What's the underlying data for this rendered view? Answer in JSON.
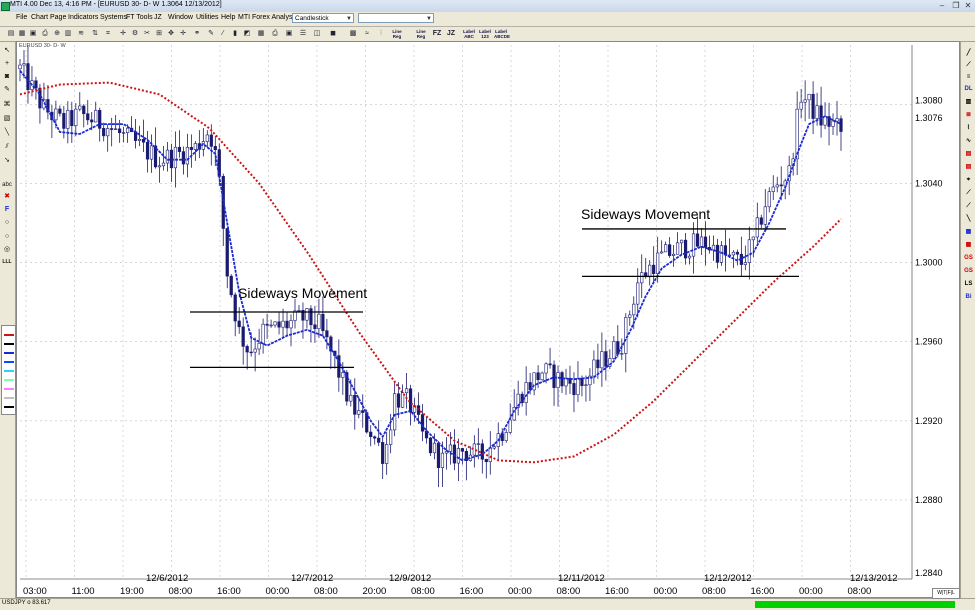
{
  "window": {
    "title": "MTI 4.00 Dec 13,  4:16 PM - [EURUSD 30-  D-  W 1.3064 12/13/2012]",
    "chart_window_title": "EURUSD 30-  D-  W"
  },
  "menu": {
    "items": [
      "File",
      "Chart",
      "Page",
      "Indicators",
      "Systems",
      "FT Tools",
      "JZ",
      "Window",
      "Utilities",
      "Help",
      "MTI Forex Analysis"
    ],
    "chart_style": "Candlestick"
  },
  "toolbar": {
    "text_buttons": [
      "Line Reg",
      "Line Reg",
      "FZ",
      "JZ",
      "Label ABC",
      "Label 123",
      "Label ABCDE"
    ]
  },
  "left_tools": [
    "cursor",
    "crosshair",
    "zoom",
    "pencil",
    "fib",
    "gann",
    "trendline",
    "channel",
    "arrow",
    "text",
    "delete",
    "font",
    "circle",
    "circle",
    "ellipse",
    "lll"
  ],
  "left_tool_labels": {
    "text": "abc",
    "font": "F",
    "lll": "LLL"
  },
  "right_tools": [
    "DL",
    "GS",
    "GS",
    "LS",
    "Bi"
  ],
  "colors": {
    "candle": "#1a1a6e",
    "candle_up_fill": "#ffffff",
    "fast_ma": "#1a2ad0",
    "slow_ma": "#cc1414",
    "grid": "#bfbfbf",
    "annotation": "#000000",
    "progress": "#00d000"
  },
  "annotations": [
    {
      "text": "Sideways Movement",
      "lines": [
        [
          1.2975,
          "12/6/2012 08:00",
          "12/7/2012 08:00"
        ],
        [
          1.2947,
          "12/6/2012 08:00",
          "12/7/2012 07:00"
        ]
      ]
    },
    {
      "text": "Sideways Movement",
      "lines": [
        [
          1.3017,
          "12/11/2012 08:00",
          "12/12/2012 15:00"
        ],
        [
          1.2993,
          "12/11/2012 08:00",
          "12/12/2012 16:00"
        ]
      ]
    }
  ],
  "chart_data": {
    "type": "candlestick",
    "symbol": "EURUSD",
    "interval": "30 min",
    "ylim": [
      1.284,
      1.311
    ],
    "yticks": [
      "1.3080",
      "1.3076",
      "1.3040",
      "1.3000",
      "1.2960",
      "1.2920",
      "1.2880",
      "1.2840"
    ],
    "xticks": [
      "03:00",
      "11:00",
      "19:00",
      "08:00",
      "16:00",
      "00:00",
      "08:00",
      "20:00",
      "08:00",
      "16:00",
      "00:00",
      "08:00",
      "16:00",
      "00:00",
      "08:00",
      "16:00",
      "00:00",
      "08:00"
    ],
    "date_labels": [
      "12/6/2012",
      "12/7/2012",
      "12/9/2012",
      "12/11/2012",
      "12/12/2012",
      "12/13/2012"
    ],
    "last_price": "1.3064",
    "path": [
      [
        0,
        1.3098
      ],
      [
        12,
        1.3078
      ],
      [
        22,
        1.307
      ],
      [
        30,
        1.3075
      ],
      [
        42,
        1.307
      ],
      [
        58,
        1.306
      ],
      [
        70,
        1.3052
      ],
      [
        80,
        1.3055
      ],
      [
        88,
        1.3058
      ],
      [
        94,
        1.3066
      ],
      [
        97,
        1.3062
      ],
      [
        100,
        1.304
      ],
      [
        104,
        1.2995
      ],
      [
        110,
        1.2965
      ],
      [
        115,
        1.2955
      ],
      [
        122,
        1.2965
      ],
      [
        132,
        1.2968
      ],
      [
        142,
        1.2972
      ],
      [
        150,
        1.2968
      ],
      [
        158,
        1.295
      ],
      [
        166,
        1.2928
      ],
      [
        176,
        1.2915
      ],
      [
        183,
        1.2902
      ],
      [
        188,
        1.2932
      ],
      [
        195,
        1.293
      ],
      [
        203,
        1.291
      ],
      [
        212,
        1.29
      ],
      [
        222,
        1.2905
      ],
      [
        232,
        1.2902
      ],
      [
        242,
        1.2915
      ],
      [
        252,
        1.2935
      ],
      [
        262,
        1.2945
      ],
      [
        272,
        1.294
      ],
      [
        282,
        1.2938
      ],
      [
        292,
        1.295
      ],
      [
        302,
        1.296
      ],
      [
        310,
        1.299
      ],
      [
        318,
        1.3
      ],
      [
        326,
        1.3005
      ],
      [
        334,
        1.3008
      ],
      [
        344,
        1.301
      ],
      [
        354,
        1.3003
      ],
      [
        362,
        1.3
      ],
      [
        368,
        1.301
      ],
      [
        374,
        1.303
      ],
      [
        380,
        1.304
      ],
      [
        386,
        1.3045
      ],
      [
        392,
        1.3085
      ],
      [
        396,
        1.308
      ],
      [
        402,
        1.3072
      ],
      [
        408,
        1.307
      ],
      [
        412,
        1.3066
      ]
    ],
    "series": [
      {
        "name": "",
        "kind": "fast_ma",
        "values": [
          [
            0,
            1.3097
          ],
          [
            10,
            1.3085
          ],
          [
            20,
            1.3066
          ],
          [
            30,
            1.3065
          ],
          [
            40,
            1.307
          ],
          [
            52,
            1.307
          ],
          [
            64,
            1.3062
          ],
          [
            74,
            1.3052
          ],
          [
            84,
            1.3052
          ],
          [
            92,
            1.306
          ],
          [
            98,
            1.3055
          ],
          [
            104,
            1.302
          ],
          [
            110,
            1.2985
          ],
          [
            116,
            1.2962
          ],
          [
            124,
            1.2958
          ],
          [
            134,
            1.2963
          ],
          [
            144,
            1.2966
          ],
          [
            152,
            1.2963
          ],
          [
            160,
            1.295
          ],
          [
            168,
            1.2935
          ],
          [
            176,
            1.292
          ],
          [
            182,
            1.2912
          ],
          [
            188,
            1.2923
          ],
          [
            196,
            1.2925
          ],
          [
            204,
            1.2915
          ],
          [
            214,
            1.2905
          ],
          [
            222,
            1.29
          ],
          [
            232,
            1.2903
          ],
          [
            240,
            1.291
          ],
          [
            248,
            1.2925
          ],
          [
            258,
            1.2938
          ],
          [
            268,
            1.2942
          ],
          [
            278,
            1.2941
          ],
          [
            288,
            1.2942
          ],
          [
            298,
            1.295
          ],
          [
            306,
            1.2965
          ],
          [
            314,
            1.2983
          ],
          [
            322,
            1.2997
          ],
          [
            332,
            1.3004
          ],
          [
            342,
            1.3008
          ],
          [
            352,
            1.3005
          ],
          [
            360,
            1.3001
          ],
          [
            368,
            1.3005
          ],
          [
            376,
            1.302
          ],
          [
            384,
            1.3038
          ],
          [
            390,
            1.3055
          ],
          [
            396,
            1.307
          ],
          [
            404,
            1.3074
          ],
          [
            412,
            1.307
          ]
        ]
      },
      {
        "name": "",
        "kind": "slow_ma",
        "values": [
          [
            0,
            1.3085
          ],
          [
            20,
            1.309
          ],
          [
            45,
            1.3091
          ],
          [
            70,
            1.3085
          ],
          [
            95,
            1.3068
          ],
          [
            120,
            1.304
          ],
          [
            145,
            1.3004
          ],
          [
            170,
            1.2965
          ],
          [
            195,
            1.293
          ],
          [
            218,
            1.291
          ],
          [
            240,
            1.29
          ],
          [
            258,
            1.2899
          ],
          [
            278,
            1.2902
          ],
          [
            298,
            1.2913
          ],
          [
            318,
            1.293
          ],
          [
            338,
            1.295
          ],
          [
            358,
            1.297
          ],
          [
            378,
            1.299
          ],
          [
            398,
            1.3008
          ],
          [
            412,
            1.3022
          ]
        ]
      }
    ]
  },
  "status": {
    "symbol_readout": "USDJPY o  83.617",
    "timeframe_buttons": "W|T|F|L"
  }
}
